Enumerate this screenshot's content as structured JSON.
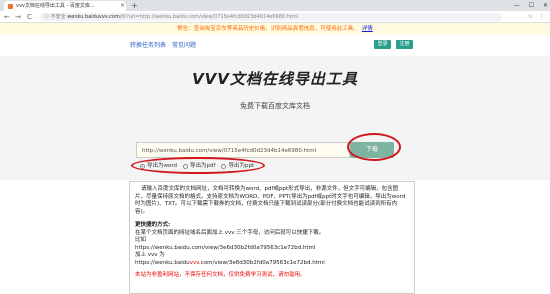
{
  "browser": {
    "tab_title": "vvv文档在线导出工具 - 百度文库...",
    "tab_close": "×",
    "new_tab": "+",
    "window_controls": [
      "—",
      "☐",
      "✕"
    ],
    "nav_back": "←",
    "nav_forward": "→",
    "nav_reload": "C",
    "security_label": "ⓘ 不安全",
    "address_host": "wenku.baiduvvv.com",
    "address_path": "/d/?url=http://wenku.baidu.com/view/0715e4fcd0d23d4b14e6980.html",
    "star_icon": "☆",
    "menu_icon": "⋮"
  },
  "notice": {
    "text": "警告：查询淘宝京东等商品历史价格，识别商品真假信息，可使用此工具。",
    "link": "详情"
  },
  "header": {
    "links": [
      "转换任务列表",
      "常见问题"
    ],
    "login": "登录",
    "register": "注册"
  },
  "hero": {
    "title": "VVV文档在线导出工具",
    "subtitle": "免费下载百度文库文档",
    "input_value": "http://wenku.baidu.com/view/0715e4fcd0d23d4b14e6980.html",
    "download_button": "下载",
    "export_options": [
      "导出为word",
      "导出为pdf",
      "导出为ppt"
    ],
    "selected_option": 0
  },
  "content": {
    "intro": "请输入百度文库的文档网址，文档可转换为word、pdf或ppt形式导出，非源文件，但文字可编辑，包含图片，尽量保持原文档的格式。支持原文档为WORD、PDF、PPT(导出为pdf或ppt时文字也可编辑，导出为word时为图片)、TXT。可以下载需下载券的文档，付费文档只能下载到试读部分(部分付费文档也能试读到所有内容)。",
    "heading": "更快捷的方式:",
    "line1": "在某个文档页面的网址域名后面加上 vvv 三个字母，访问后就可以快捷下载。",
    "line2": "比如",
    "line3": "https://wenku.baidu.com/view/3e6d30b2fd0a79563c1e72bd.html",
    "line4": "加上 vvv 为",
    "line5_a": "https://wenku.baidu",
    "line5_b": "vvv",
    "line5_c": ".com/view/3e6d30b2fd0a79563c1e72bd.html",
    "footer": "本站为非盈利网站，不保存任何文档，仅供免费学习测试，请勿滥用。"
  }
}
